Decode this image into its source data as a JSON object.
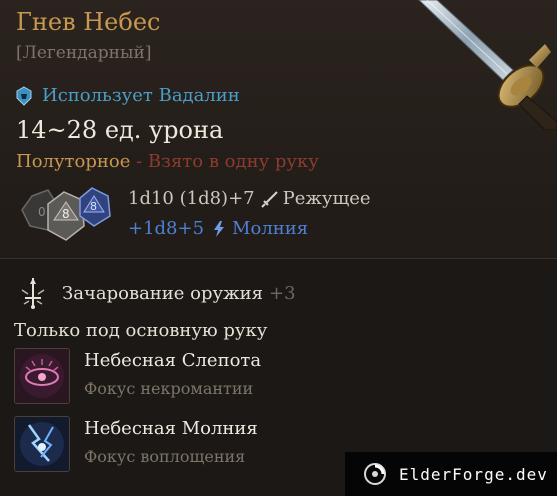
{
  "item": {
    "name": "Гнев Небес",
    "rarity": "[Легендарный]",
    "user": "Использует Вадалин",
    "damage": "14~28 ед. урона",
    "hand_type": "Полуторное",
    "hand_sep": " - ",
    "hand_desc": "Взято в одну руку"
  },
  "dice": {
    "die1": "0",
    "die2": "8",
    "die3": "8"
  },
  "damage_lines": {
    "line1_value": "1d10 (1d8)+7",
    "line1_type": "Режущее",
    "line2_value": "+1d8+5",
    "line2_type": "Молния"
  },
  "enchantment": {
    "name": "Зачарование оружия",
    "bonus": "+3"
  },
  "restriction": "Только под основную руку",
  "spells": [
    {
      "name": "Небесная Слепота",
      "desc": "Фокус некромантии"
    },
    {
      "name": "Небесная Молния",
      "desc": "Фокус воплощения"
    }
  ],
  "watermark": "ElderForge.dev",
  "icons": {
    "user": "helmet-icon",
    "slashing": "dagger-icon",
    "lightning": "lightning-icon",
    "enchant": "sword-enchant-icon",
    "watermark_logo": "swirl-logo-icon"
  },
  "colors": {
    "title": "#c9974f",
    "user": "#4a9ec7",
    "lightning": "#4f7fd3",
    "restriction_red": "#8e3b2e"
  }
}
